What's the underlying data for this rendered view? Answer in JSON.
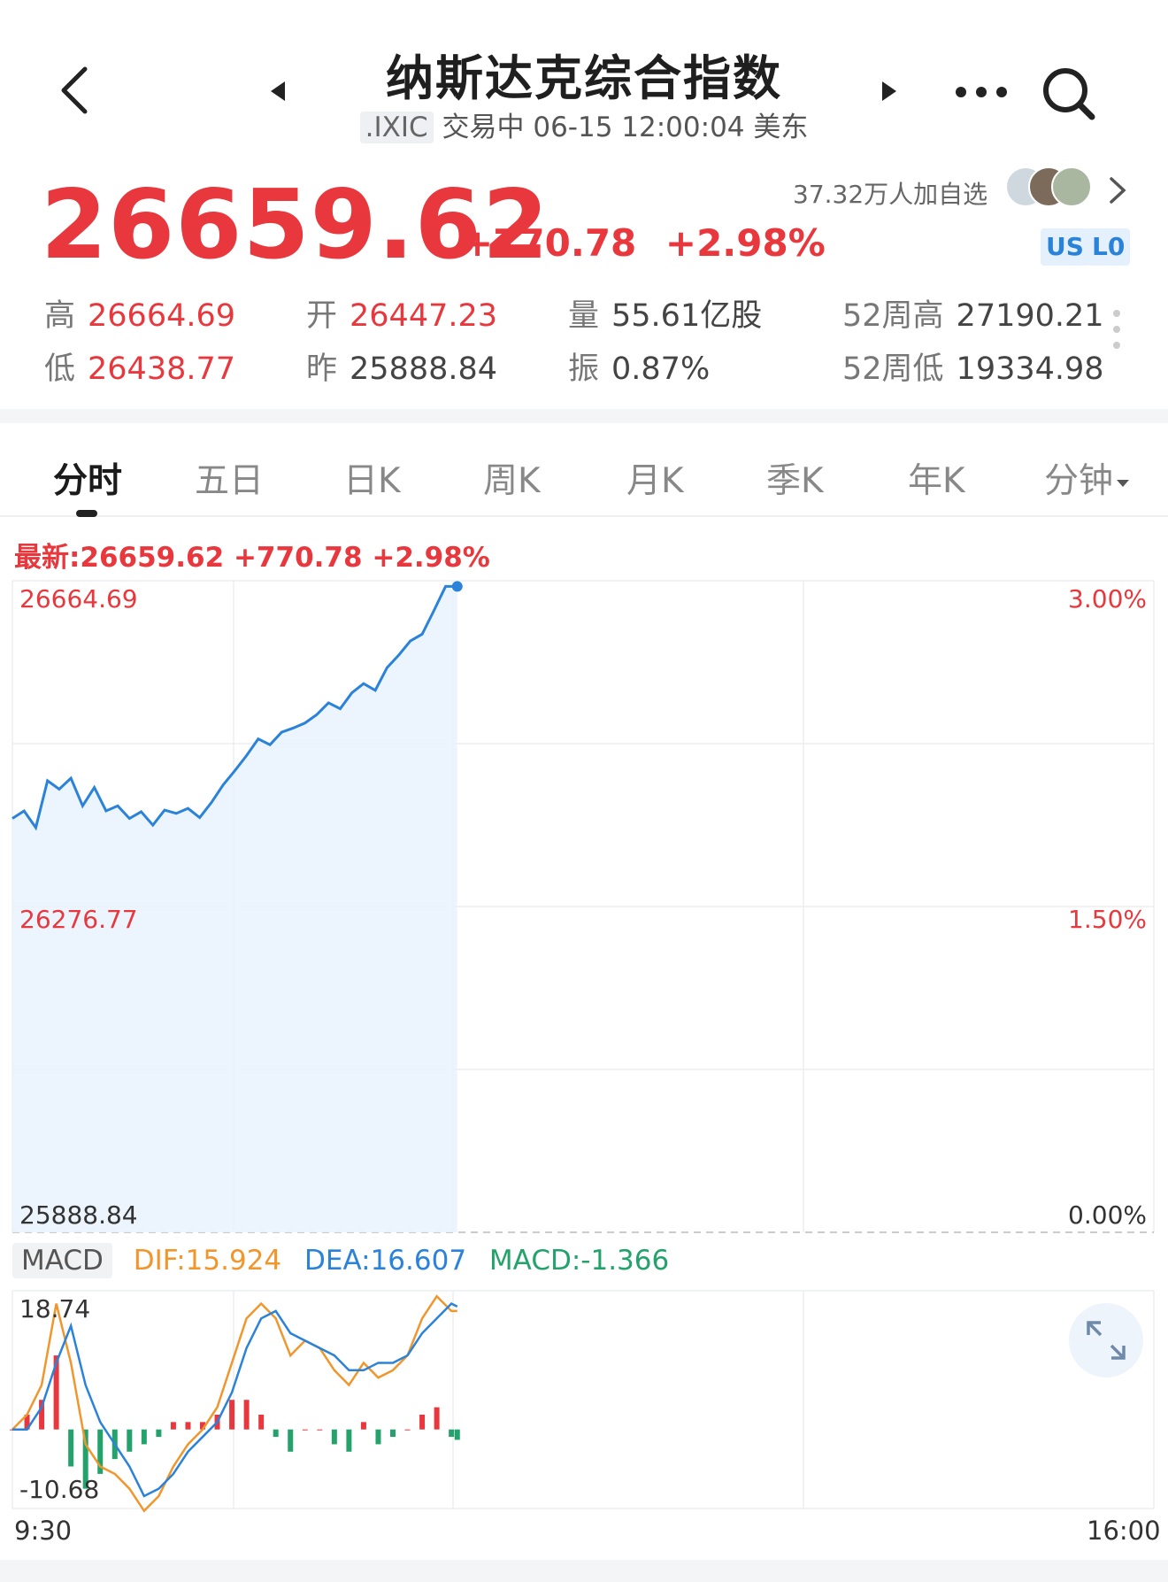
{
  "header": {
    "title": "纳斯达克综合指数",
    "code": ".IXIC",
    "status": "交易中 06-15 12:00:04 美东"
  },
  "quote": {
    "price": "26659.62",
    "change": "+770.78",
    "change_pct": "+2.98%",
    "followers": "37.32万人加自选",
    "badges": [
      "US",
      "L0"
    ]
  },
  "stats": {
    "high": {
      "label": "高",
      "value": "26664.69"
    },
    "low": {
      "label": "低",
      "value": "26438.77"
    },
    "open": {
      "label": "开",
      "value": "26447.23"
    },
    "prev": {
      "label": "昨",
      "value": "25888.84"
    },
    "volume": {
      "label": "量",
      "value": "55.61亿股"
    },
    "amplitude": {
      "label": "振",
      "value": "0.87%"
    },
    "w52_high": {
      "label": "52周高",
      "value": "27190.21"
    },
    "w52_low": {
      "label": "52周低",
      "value": "19334.98"
    }
  },
  "tabs": [
    "分时",
    "五日",
    "日K",
    "周K",
    "月K",
    "季K",
    "年K",
    "分钟"
  ],
  "latest_line": "最新:26659.62  +770.78  +2.98%",
  "macd": {
    "tag": "MACD",
    "dif": "DIF:15.924",
    "dea": "DEA:16.607",
    "macd": "MACD:-1.366"
  },
  "colors": {
    "up": "#e8383d",
    "down": "#23a36b",
    "price_line": "#2b82d9",
    "dif": "#f0962d",
    "dea": "#2b82d9",
    "macd_text": "#23a36b"
  },
  "chart_data": [
    {
      "type": "line",
      "title": "分时",
      "x_labels": [
        "9:30",
        "16:00"
      ],
      "y_labels_left": [
        "26664.69",
        "26276.77",
        "25888.84"
      ],
      "y_labels_right": [
        "3.00%",
        "1.50%",
        "0.00%"
      ],
      "ylim": [
        25888.84,
        26664.69
      ],
      "x_minutes_range": [
        0,
        390
      ],
      "series": [
        {
          "x": [
            0,
            4,
            8,
            12,
            16,
            20,
            24,
            28,
            32,
            36,
            40,
            44,
            48,
            52,
            56,
            60,
            64,
            68,
            72,
            76,
            80,
            84,
            88,
            92,
            96,
            100,
            104,
            108,
            112,
            116,
            120,
            124,
            128,
            132,
            136,
            140,
            144,
            148,
            152
          ],
          "values": [
            26383,
            26392,
            26372,
            26428,
            26418,
            26431,
            26398,
            26420,
            26392,
            26398,
            26383,
            26391,
            26375,
            26393,
            26389,
            26395,
            26384,
            26402,
            26423,
            26440,
            26458,
            26478,
            26471,
            26486,
            26491,
            26497,
            26507,
            26521,
            26514,
            26533,
            26544,
            26536,
            26563,
            26578,
            26595,
            26603,
            26631,
            26660,
            26660
          ]
        }
      ]
    },
    {
      "type": "line",
      "title": "MACD",
      "y_labels_left": [
        "18.74",
        "-10.68"
      ],
      "ylim": [
        -10.68,
        18.74
      ],
      "x_minutes_range": [
        0,
        390
      ],
      "series": [
        {
          "name": "DIF",
          "x": [
            0,
            5,
            10,
            15,
            20,
            25,
            30,
            35,
            40,
            45,
            50,
            55,
            60,
            65,
            70,
            75,
            80,
            85,
            90,
            95,
            100,
            105,
            110,
            115,
            120,
            125,
            130,
            135,
            140,
            145,
            150,
            152
          ],
          "values": [
            0,
            2,
            6,
            17,
            9,
            -2,
            -5,
            -6,
            -8,
            -11,
            -9,
            -5,
            -2,
            0,
            3,
            9,
            15,
            17,
            15,
            10,
            12,
            11,
            8,
            6,
            9,
            7,
            8,
            10,
            15,
            18,
            16,
            16
          ]
        },
        {
          "name": "DEA",
          "x": [
            0,
            5,
            10,
            15,
            20,
            25,
            30,
            35,
            40,
            45,
            50,
            55,
            60,
            65,
            70,
            75,
            80,
            85,
            90,
            95,
            100,
            105,
            110,
            115,
            120,
            125,
            130,
            135,
            140,
            145,
            150,
            152
          ],
          "values": [
            0,
            0,
            3,
            9,
            14,
            6,
            1,
            -2,
            -5,
            -9,
            -8,
            -6,
            -3,
            -1,
            1,
            5,
            11,
            15,
            16,
            13,
            12,
            11,
            10,
            8,
            8,
            9,
            9,
            10,
            13,
            15,
            17,
            16.6
          ]
        },
        {
          "name": "MACD",
          "x": [
            0,
            5,
            10,
            15,
            20,
            25,
            30,
            35,
            40,
            45,
            50,
            55,
            60,
            65,
            70,
            75,
            80,
            85,
            90,
            95,
            100,
            105,
            110,
            115,
            120,
            125,
            130,
            135,
            140,
            145,
            150,
            152
          ],
          "values": [
            0,
            2,
            4,
            10,
            -5,
            -8,
            -6,
            -4,
            -3,
            -2,
            -1,
            1,
            1,
            1,
            2,
            4,
            4,
            2,
            -1,
            -3,
            0,
            0,
            -2,
            -3,
            1,
            -2,
            -1,
            0,
            2,
            3,
            -1,
            -1.4
          ]
        }
      ]
    }
  ]
}
